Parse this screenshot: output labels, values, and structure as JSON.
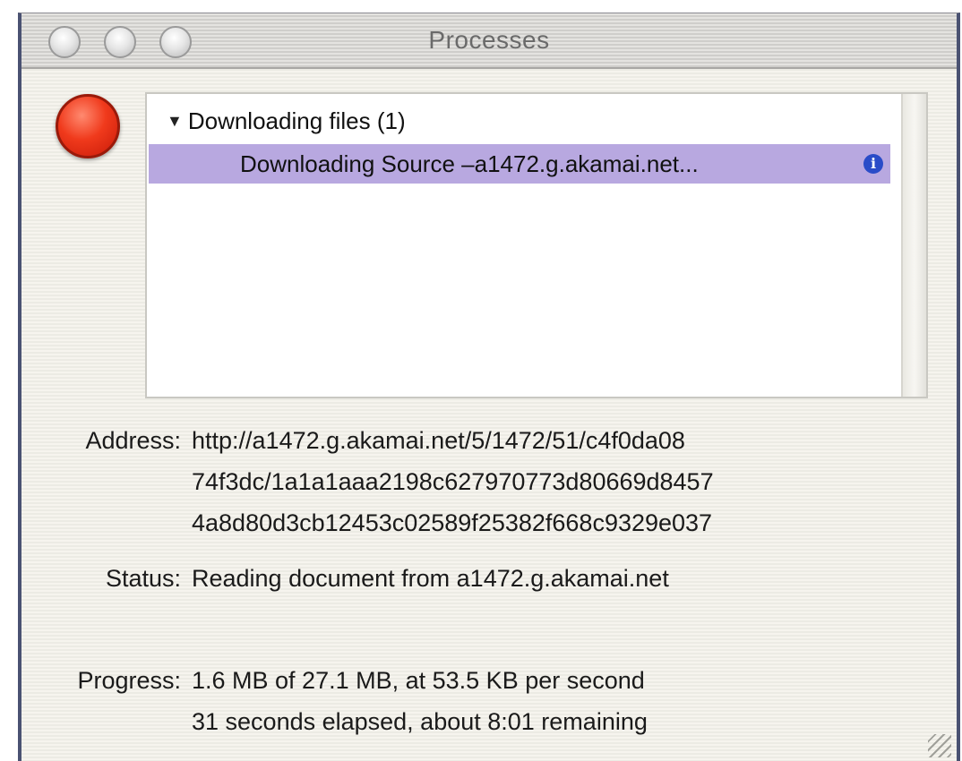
{
  "window": {
    "title": "Processes"
  },
  "toolbar": {
    "stop_icon": "stop-icon"
  },
  "list": {
    "group_label": "Downloading files (1)",
    "items": [
      {
        "label": "Downloading Source –a1472.g.akamai.net...",
        "info_icon": "i",
        "selected": true
      }
    ]
  },
  "details": {
    "address_label": "Address:",
    "address_lines": [
      "http://a1472.g.akamai.net/5/1472/51/c4f0da08",
      "74f3dc/1a1a1aaa2198c627970773d80669d8457",
      "4a8d80d3cb12453c02589f25382f668c9329e037"
    ],
    "status_label": "Status:",
    "status_value": "Reading document from a1472.g.akamai.net",
    "progress_label": "Progress:",
    "progress_lines": [
      "1.6 MB of 27.1 MB, at 53.5 KB per second",
      "31 seconds elapsed, about 8:01 remaining"
    ]
  },
  "colors": {
    "selection": "#b8a8e0",
    "stop_button": "#f03a1c",
    "info_icon": "#2a4cc8",
    "window_border": "#4a5272"
  }
}
